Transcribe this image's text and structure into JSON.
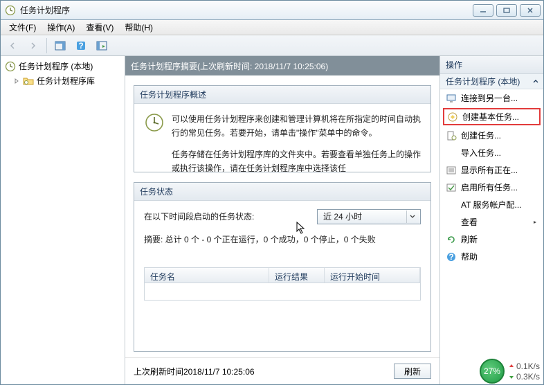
{
  "window": {
    "title": "任务计划程序"
  },
  "menubar": {
    "file": "文件(F)",
    "action": "操作(A)",
    "view": "查看(V)",
    "help": "帮助(H)"
  },
  "tree": {
    "root": "任务计划程序 (本地)",
    "library": "任务计划程序库"
  },
  "midHeader": {
    "text": "任务计划程序摘要(上次刷新时间: 2018/11/7 10:25:06)"
  },
  "overview": {
    "title": "任务计划程序概述",
    "p1": "可以使用任务计划程序来创建和管理计算机将在所指定的时间自动执行的常见任务。若要开始，请单击\"操作\"菜单中的命令。",
    "p2": "任务存储在任务计划程序库的文件夹中。若要查看单独任务上的操作或执行该操作，请在任务计划程序库中选择该任"
  },
  "status": {
    "title": "任务状态",
    "label": "在以下时间段启动的任务状态:",
    "combo": "近 24 小时",
    "summary": "摘要: 总计 0 个 - 0 个正在运行，0 个成功，0 个停止，0 个失败"
  },
  "grid": {
    "col1": "任务名",
    "col2": "运行结果",
    "col3": "运行开始时间"
  },
  "footer": {
    "lastRefresh": "上次刷新时间2018/11/7 10:25:06",
    "refresh": "刷新"
  },
  "actions": {
    "header": "操作",
    "subheader": "任务计划程序 (本地)",
    "items": {
      "connect": "连接到另一台...",
      "createBasic": "创建基本任务...",
      "createTask": "创建任务...",
      "import": "导入任务...",
      "showRunning": "显示所有正在...",
      "enableHistory": "启用所有任务...",
      "atService": "AT 服务帐户配...",
      "view": "查看",
      "refresh": "刷新",
      "help": "帮助"
    }
  },
  "floating": {
    "percent": "27%",
    "up": "0.1K/s",
    "down": "0.3K/s"
  }
}
